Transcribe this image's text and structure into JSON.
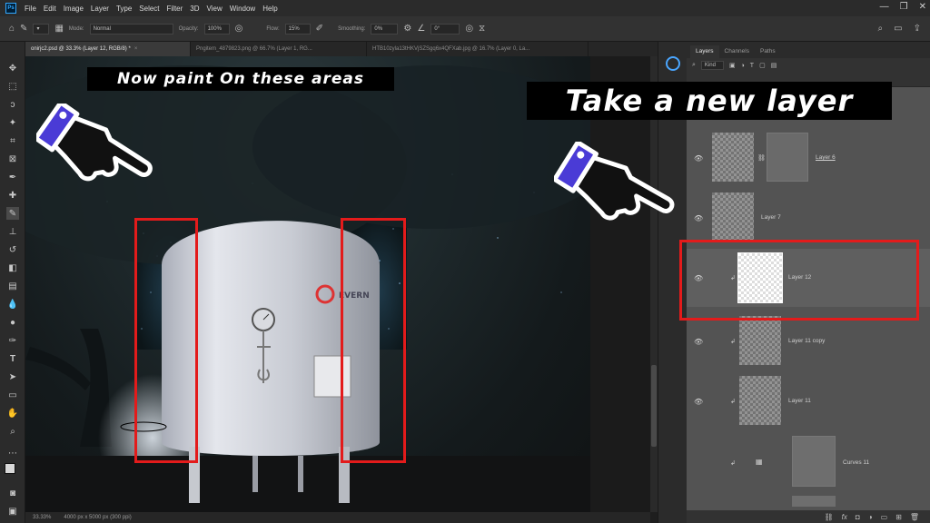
{
  "menu": {
    "app_logo": "Ps",
    "items": [
      "File",
      "Edit",
      "Image",
      "Layer",
      "Type",
      "Select",
      "Filter",
      "3D",
      "View",
      "Window",
      "Help"
    ]
  },
  "options_bar": {
    "mode_label": "Mode:",
    "mode_value": "Normal",
    "opacity_label": "Opacity:",
    "opacity_value": "100%",
    "flow_label": "Flow:",
    "flow_value": "15%",
    "smoothing_label": "Smoothing:",
    "smoothing_value": "0%",
    "angle_value": "0°"
  },
  "tabs": [
    {
      "label": "onirjc2.psd @ 33.3% (Layer 12, RGB/8) *",
      "active": true
    },
    {
      "label": "Pngitem_4879823.png @ 66.7% (Layer 1, RG...",
      "active": false
    },
    {
      "label": "HTB10zyla13tHKVjSZSgq6x4QFXab.jpg @ 16.7% (Layer 0, La...",
      "active": false
    }
  ],
  "status": {
    "zoom": "33.33%",
    "doc_size": "4000 px x 5000 px (300 ppi)"
  },
  "panel_tabs": [
    "Layers",
    "Channels",
    "Paths"
  ],
  "layers": {
    "filter_kind": "Kind",
    "items": [
      {
        "name": "Layer 6",
        "selected": false
      },
      {
        "name": "Layer 7",
        "selected": false
      },
      {
        "name": "Layer 12",
        "selected": true
      },
      {
        "name": "Layer 11 copy",
        "selected": false
      },
      {
        "name": "Layer 11",
        "selected": false
      },
      {
        "name": "Curves 11",
        "selected": false
      }
    ]
  },
  "overlays": {
    "left_caption": "Now paint On these areas",
    "right_caption": "Take a new layer"
  },
  "tank_logo_text": "EVERN",
  "colors": {
    "highlight_red": "#e31b1b",
    "hand_blue": "#4a3bd6",
    "accent_blue": "#31a8ff"
  }
}
